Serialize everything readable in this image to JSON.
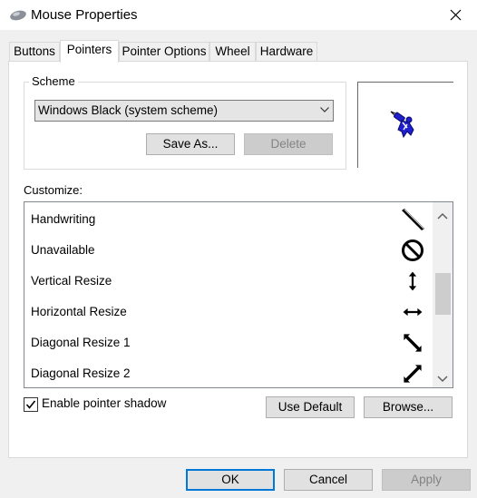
{
  "window": {
    "title": "Mouse Properties"
  },
  "tabs": [
    {
      "label": "Buttons"
    },
    {
      "label": "Pointers"
    },
    {
      "label": "Pointer Options"
    },
    {
      "label": "Wheel"
    },
    {
      "label": "Hardware"
    }
  ],
  "scheme": {
    "label": "Scheme",
    "selected": "Windows Black (system scheme)",
    "save_as": "Save As...",
    "delete": "Delete"
  },
  "customize": {
    "label": "Customize:",
    "items": [
      {
        "label": "Handwriting",
        "icon": "handwriting-pen-icon"
      },
      {
        "label": "Unavailable",
        "icon": "unavailable-icon"
      },
      {
        "label": "Vertical Resize",
        "icon": "vertical-resize-icon"
      },
      {
        "label": "Horizontal Resize",
        "icon": "horizontal-resize-icon"
      },
      {
        "label": "Diagonal Resize 1",
        "icon": "diagonal-resize-1-icon"
      },
      {
        "label": "Diagonal Resize 2",
        "icon": "diagonal-resize-2-icon"
      }
    ]
  },
  "pointer_shadow": {
    "label": "Enable pointer shadow",
    "checked": true
  },
  "buttons": {
    "use_default": "Use Default",
    "browse": "Browse...",
    "ok": "OK",
    "cancel": "Cancel",
    "apply": "Apply"
  },
  "colors": {
    "accent": "#0078d7",
    "preview_cursor": "#1f1fcf"
  }
}
